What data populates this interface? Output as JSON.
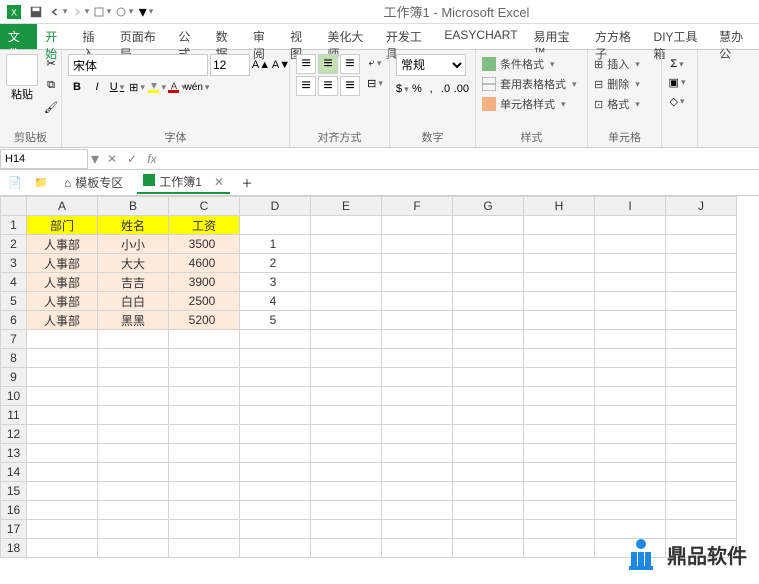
{
  "title": "工作簿1 - Microsoft Excel",
  "tabs": {
    "file": "文件",
    "start": "开始",
    "insert": "插入",
    "layout": "页面布局",
    "formula": "公式",
    "data": "数据",
    "review": "审阅",
    "view": "视图",
    "beauty": "美化大师",
    "dev": "开发工具",
    "easy": "EASYCHART",
    "yiybao": "易用宝 ™",
    "fang": "方方格子",
    "diy": "DIY工具箱",
    "hui": "慧办公"
  },
  "ribbon": {
    "clipboard": {
      "label": "剪贴板",
      "paste": "粘贴"
    },
    "font": {
      "label": "字体",
      "name": "宋体",
      "size": "12",
      "bold": "B",
      "italic": "I",
      "underline": "U",
      "wen": "wén"
    },
    "align": {
      "label": "对齐方式"
    },
    "number": {
      "label": "数字",
      "format": "常规",
      "currency": "$"
    },
    "styles": {
      "label": "样式",
      "cond": "条件格式",
      "tbl": "套用表格格式",
      "cell": "单元格样式"
    },
    "cells": {
      "label": "单元格",
      "insert": "插入",
      "delete": "删除",
      "format": "格式"
    }
  },
  "nameBox": "H14",
  "fx": "fx",
  "docTab": {
    "template": "模板专区",
    "book": "工作簿1"
  },
  "columns": [
    "A",
    "B",
    "C",
    "D",
    "E",
    "F",
    "G",
    "H",
    "I",
    "J"
  ],
  "rows": [
    "1",
    "2",
    "3",
    "4",
    "5",
    "6",
    "7",
    "8",
    "9",
    "10",
    "11",
    "12",
    "13",
    "14",
    "15",
    "16",
    "17",
    "18"
  ],
  "header": [
    "部门",
    "姓名",
    "工资"
  ],
  "data": [
    [
      "人事部",
      "小小",
      "3500"
    ],
    [
      "人事部",
      "大大",
      "4600"
    ],
    [
      "人事部",
      "吉吉",
      "3900"
    ],
    [
      "人事部",
      "白白",
      "2500"
    ],
    [
      "人事部",
      "黑黑",
      "5200"
    ]
  ],
  "colD": [
    "1",
    "2",
    "3",
    "4",
    "5"
  ],
  "watermark": "鼎品软件",
  "chart_data": {
    "type": "table",
    "columns": [
      "部门",
      "姓名",
      "工资"
    ],
    "rows": [
      [
        "人事部",
        "小小",
        3500
      ],
      [
        "人事部",
        "大大",
        4600
      ],
      [
        "人事部",
        "吉吉",
        3900
      ],
      [
        "人事部",
        "白白",
        2500
      ],
      [
        "人事部",
        "黑黑",
        5200
      ]
    ]
  }
}
